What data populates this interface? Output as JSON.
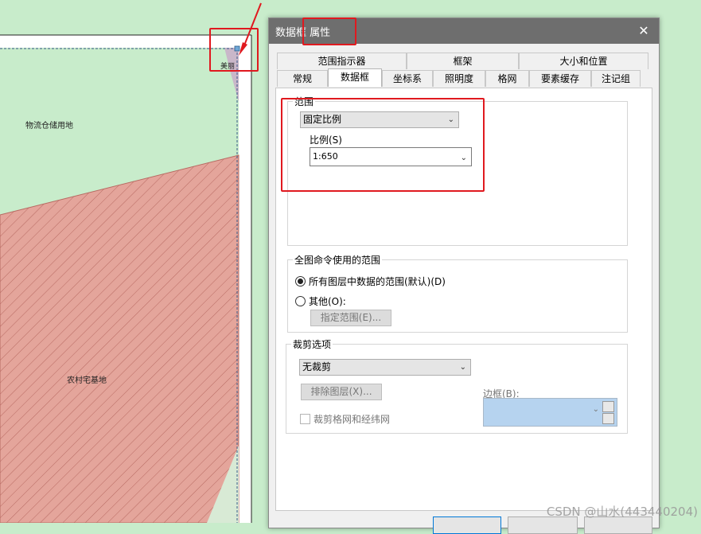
{
  "map": {
    "label_logistics": "物流仓储用地",
    "label_rural": "农村宅基地",
    "label_partial": "美丽"
  },
  "dialog": {
    "title": "数据框 属性",
    "close_glyph": "✕",
    "tabs_row1": [
      "范围指示器",
      "框架",
      "大小和位置"
    ],
    "tabs_row2": [
      "常规",
      "数据框",
      "坐标系",
      "照明度",
      "格网",
      "要素缓存",
      "注记组"
    ],
    "active_tab": "数据框"
  },
  "extent": {
    "group_title": "范围",
    "mode_value": "固定比例",
    "scale_label": "比例(S)",
    "scale_value": "1:650"
  },
  "full_extent": {
    "group_title": "全图命令使用的范围",
    "option_default": "所有图层中数据的范围(默认)(D)",
    "option_other": "其他(O):",
    "specify_button": "指定范围(E)..."
  },
  "clip": {
    "group_title": "裁剪选项",
    "mode_value": "无裁剪",
    "exclude_button": "排除图层(X)...",
    "border_label": "边框(B):",
    "clip_grid_label": "裁剪格网和经纬网"
  },
  "watermark": "CSDN @山水(443440204)",
  "colors": {
    "highlight": "#e0191f",
    "map_green": "#c8eccb",
    "rural_fill": "#e4a59b",
    "border_swatch": "#b6d3ef"
  }
}
